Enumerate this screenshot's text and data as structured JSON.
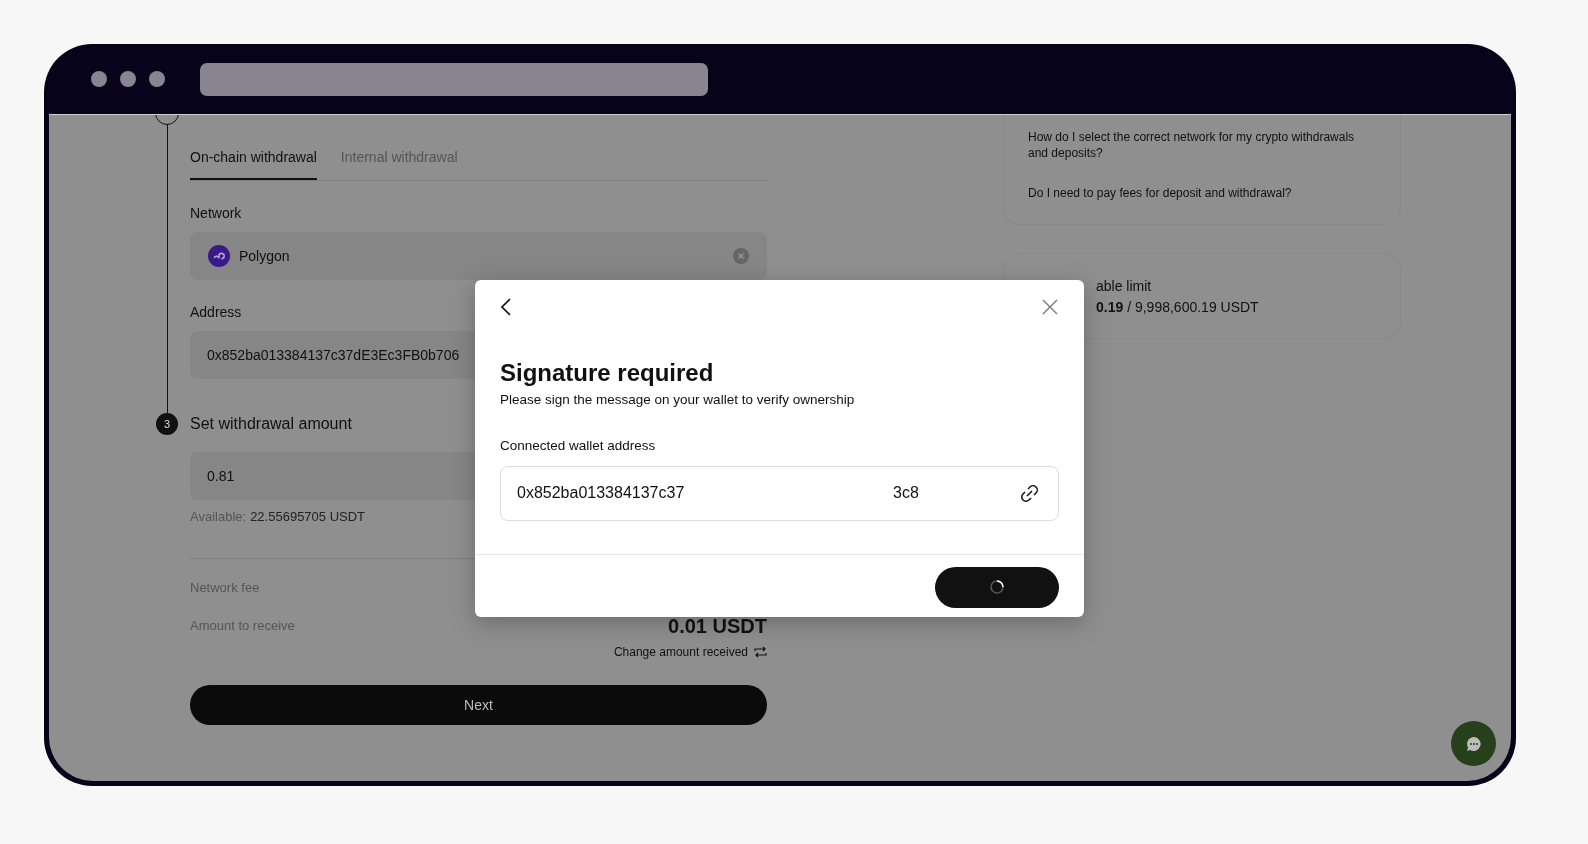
{
  "destination_tabs": [
    {
      "label": "On-chain withdrawal",
      "selected": true
    },
    {
      "label": "Internal withdrawal",
      "selected": false
    }
  ],
  "network": {
    "label": "Network",
    "value": "Polygon"
  },
  "address": {
    "label": "Address",
    "value": "0x852ba013384137c37dE3Ec3FB0b706"
  },
  "amount_step": {
    "number": "3",
    "title": "Set withdrawal amount",
    "value": "0.81",
    "available_label": "Available:",
    "available_value": "22.55695705 USDT"
  },
  "summary": {
    "network_fee_label": "Network fee",
    "receive_label": "Amount to receive",
    "receive_value": "0.01 USDT",
    "change_link": "Change amount received"
  },
  "next_button": "Next",
  "faq": [
    "How do I select the correct network for my crypto withdrawals and deposits?",
    "Do I need to pay fees for deposit and withdrawal?"
  ],
  "limit": {
    "title": "able limit",
    "value": "**0.19** / 9,998,600.19 USDT"
  },
  "modal": {
    "title": "Signature required",
    "subtitle": "Please sign the message on your wallet to verify ownership",
    "field_label": "Connected wallet address",
    "address_start": "0x852ba013384137c37",
    "address_end": "3c8",
    "confirm_loading": true
  }
}
